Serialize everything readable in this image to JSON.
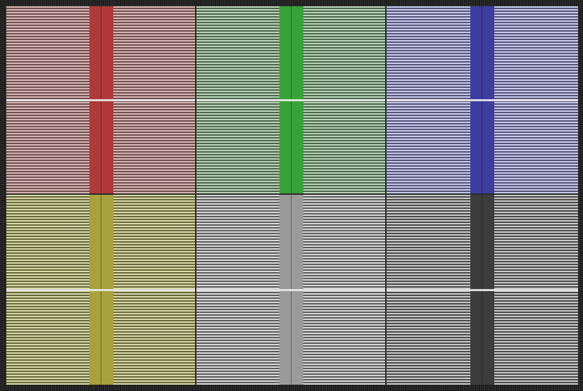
{
  "panels": [
    {
      "id": "red",
      "stripe_light": "#d9b7b7",
      "stripe_dark": "#6e5050",
      "bar": "#b03a3a"
    },
    {
      "id": "green",
      "stripe_light": "#b9d3b9",
      "stripe_dark": "#4d684d",
      "bar": "#37a337"
    },
    {
      "id": "blue",
      "stripe_light": "#c9c9ea",
      "stripe_dark": "#55557a",
      "bar": "#3d3d9f"
    },
    {
      "id": "yellow",
      "stripe_light": "#d9d9a5",
      "stripe_dark": "#68683f",
      "bar": "#a7a23c"
    },
    {
      "id": "gray",
      "stripe_light": "#d7d7d7",
      "stripe_dark": "#5d5d5d",
      "bar": "#9a9a9a"
    },
    {
      "id": "dark",
      "stripe_light": "#c9c9c9",
      "stripe_dark": "#4a4a4a",
      "bar": "#3c3c3c"
    }
  ]
}
